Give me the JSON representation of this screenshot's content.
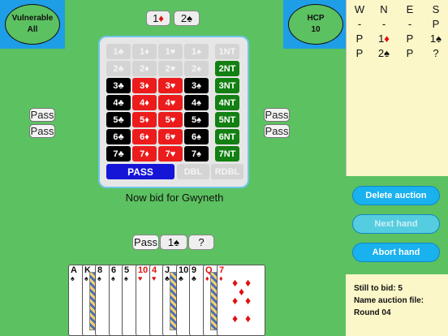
{
  "vulnerable": {
    "line1": "Vulnerable",
    "line2": "All"
  },
  "hcp": {
    "line1": "HCP",
    "line2": "10"
  },
  "partner_bid": {
    "level1": "1",
    "suit1": "♦",
    "level2": "2",
    "suit2": "♠"
  },
  "bidding_box": {
    "rows": [
      {
        "level": "1",
        "cells": [
          "1♣",
          "1♦",
          "1♥",
          "1♠"
        ],
        "nt": "1NT",
        "state": "disabled"
      },
      {
        "level": "2",
        "cells": [
          "2♣",
          "2♦",
          "2♥",
          "2♠"
        ],
        "nt": "2NT",
        "state": "mixed"
      },
      {
        "level": "3",
        "cells": [
          "3♣",
          "3♦",
          "3♥",
          "3♠"
        ],
        "nt": "3NT",
        "state": "enabled"
      },
      {
        "level": "4",
        "cells": [
          "4♣",
          "4♦",
          "4♥",
          "4♠"
        ],
        "nt": "4NT",
        "state": "enabled"
      },
      {
        "level": "5",
        "cells": [
          "5♣",
          "5♦",
          "5♥",
          "5♠"
        ],
        "nt": "5NT",
        "state": "enabled"
      },
      {
        "level": "6",
        "cells": [
          "6♣",
          "6♦",
          "6♥",
          "6♠"
        ],
        "nt": "6NT",
        "state": "enabled"
      },
      {
        "level": "7",
        "cells": [
          "7♣",
          "7♦",
          "7♥",
          "7♠"
        ],
        "nt": "7NT",
        "state": "enabled"
      }
    ],
    "pass_label": "PASS",
    "dbl_label": "DBL",
    "rdbl_label": "RDBL"
  },
  "west_bids": [
    "Pass",
    "Pass"
  ],
  "east_bids": [
    "Pass",
    "Pass"
  ],
  "prompt": "Now bid for Gwyneth",
  "south_bids": {
    "pass": "Pass",
    "bid_level": "1",
    "bid_suit": "♠",
    "unknown": "?"
  },
  "auction": {
    "headers": [
      "W",
      "N",
      "E",
      "S"
    ],
    "rows": [
      [
        "-",
        "-",
        "-",
        "P"
      ],
      [
        "P",
        "1♦",
        "P",
        "1♠"
      ],
      [
        "P",
        "2♠",
        "P",
        "?"
      ]
    ]
  },
  "buttons": {
    "delete_auction": "Delete auction",
    "next_hand": "Next hand",
    "abort_hand": "Abort hand"
  },
  "info": {
    "still_to_bid": "Still to bid: 5",
    "name_label": "Name auction file:",
    "name_value": "Round 04"
  },
  "hand": [
    {
      "rank": "A",
      "suit": "♠",
      "color": "black"
    },
    {
      "rank": "K",
      "suit": "♠",
      "color": "black"
    },
    {
      "rank": "8",
      "suit": "♠",
      "color": "black"
    },
    {
      "rank": "6",
      "suit": "♠",
      "color": "black"
    },
    {
      "rank": "5",
      "suit": "♠",
      "color": "black"
    },
    {
      "rank": "10",
      "suit": "♥",
      "color": "red"
    },
    {
      "rank": "4",
      "suit": "♥",
      "color": "red"
    },
    {
      "rank": "J",
      "suit": "♣",
      "color": "black"
    },
    {
      "rank": "10",
      "suit": "♣",
      "color": "black"
    },
    {
      "rank": "9",
      "suit": "♣",
      "color": "black"
    },
    {
      "rank": "Q",
      "suit": "♦",
      "color": "red"
    },
    {
      "rank": "7",
      "suit": "♦",
      "color": "red"
    }
  ]
}
